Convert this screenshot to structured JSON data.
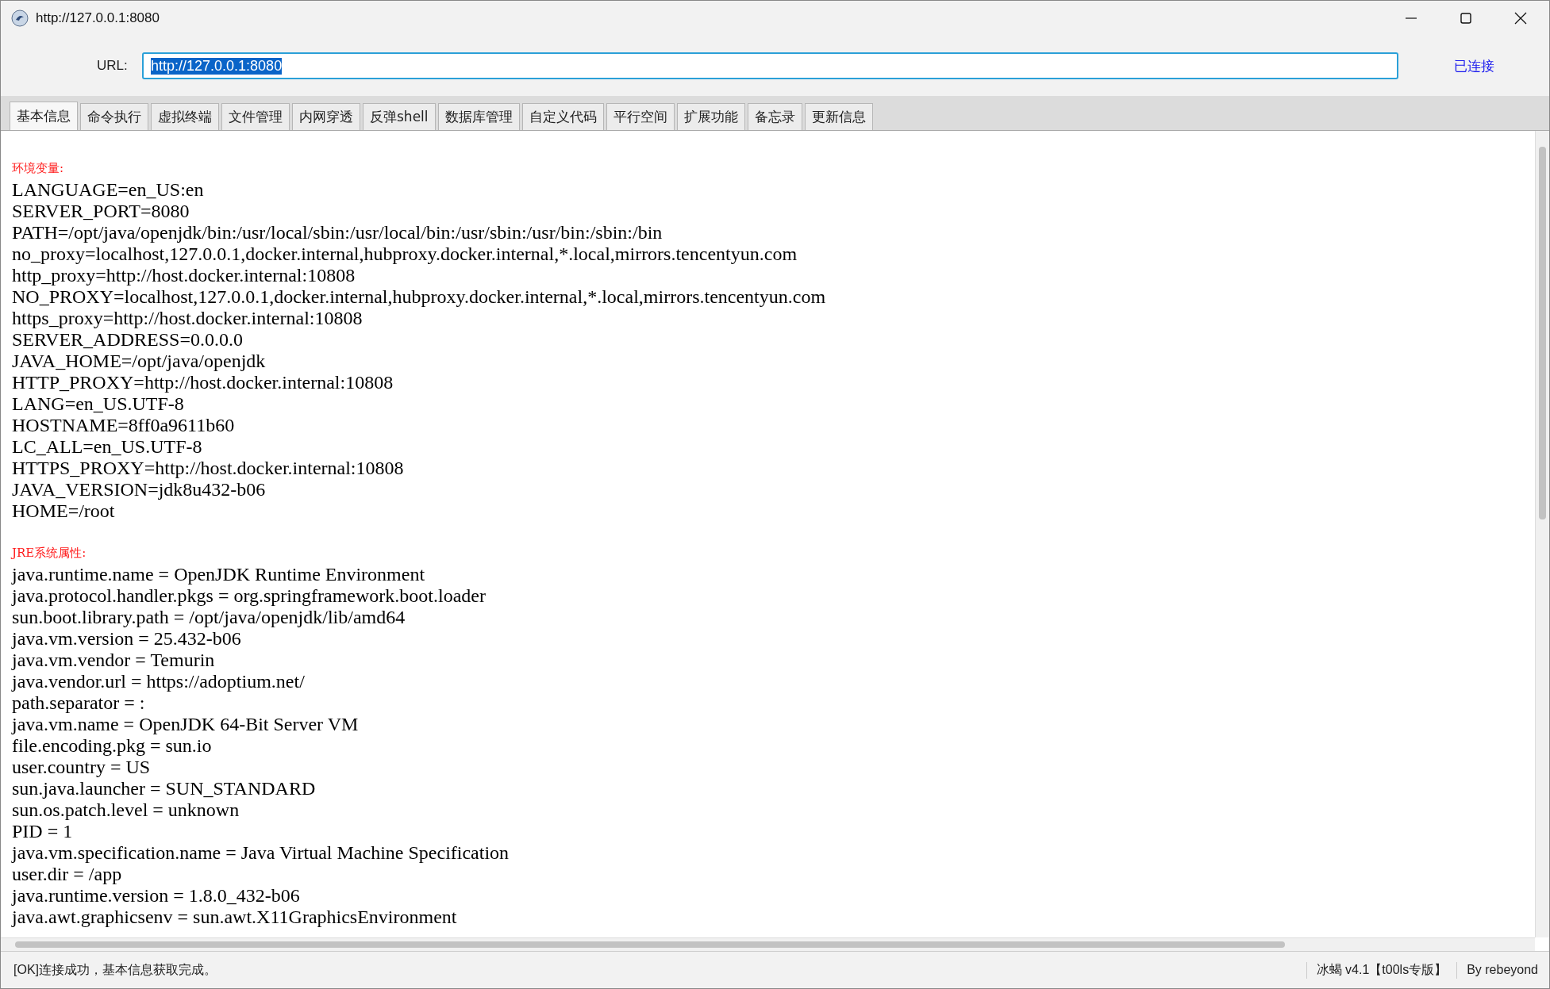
{
  "window": {
    "title": "http://127.0.0.1:8080"
  },
  "url_bar": {
    "label": "URL:",
    "value": "http://127.0.0.1:8080",
    "connection_status": "已连接"
  },
  "tabs": [
    {
      "label": "基本信息",
      "selected": true
    },
    {
      "label": "命令执行",
      "selected": false
    },
    {
      "label": "虚拟终端",
      "selected": false
    },
    {
      "label": "文件管理",
      "selected": false
    },
    {
      "label": "内网穿透",
      "selected": false
    },
    {
      "label": "反弹shell",
      "selected": false
    },
    {
      "label": "数据库管理",
      "selected": false
    },
    {
      "label": "自定义代码",
      "selected": false
    },
    {
      "label": "平行空间",
      "selected": false
    },
    {
      "label": "扩展功能",
      "selected": false
    },
    {
      "label": "备忘录",
      "selected": false
    },
    {
      "label": "更新信息",
      "selected": false
    }
  ],
  "content": {
    "sections": [
      {
        "heading": "环境变量:",
        "lines": [
          "LANGUAGE=en_US:en",
          "SERVER_PORT=8080",
          "PATH=/opt/java/openjdk/bin:/usr/local/sbin:/usr/local/bin:/usr/sbin:/usr/bin:/sbin:/bin",
          "no_proxy=localhost,127.0.0.1,docker.internal,hubproxy.docker.internal,*.local,mirrors.tencentyun.com",
          "http_proxy=http://host.docker.internal:10808",
          "NO_PROXY=localhost,127.0.0.1,docker.internal,hubproxy.docker.internal,*.local,mirrors.tencentyun.com",
          "https_proxy=http://host.docker.internal:10808",
          "SERVER_ADDRESS=0.0.0.0",
          "JAVA_HOME=/opt/java/openjdk",
          "HTTP_PROXY=http://host.docker.internal:10808",
          "LANG=en_US.UTF-8",
          "HOSTNAME=8ff0a9611b60",
          "LC_ALL=en_US.UTF-8",
          "HTTPS_PROXY=http://host.docker.internal:10808",
          "JAVA_VERSION=jdk8u432-b06",
          "HOME=/root"
        ]
      },
      {
        "heading": "JRE系统属性:",
        "lines": [
          "java.runtime.name = OpenJDK Runtime Environment",
          "java.protocol.handler.pkgs = org.springframework.boot.loader",
          "sun.boot.library.path = /opt/java/openjdk/lib/amd64",
          "java.vm.version = 25.432-b06",
          "java.vm.vendor = Temurin",
          "java.vendor.url = https://adoptium.net/",
          "path.separator = :",
          "java.vm.name = OpenJDK 64-Bit Server VM",
          "file.encoding.pkg = sun.io",
          "user.country = US",
          "sun.java.launcher = SUN_STANDARD",
          "sun.os.patch.level = unknown",
          "PID = 1",
          "java.vm.specification.name = Java Virtual Machine Specification",
          "user.dir = /app",
          "java.runtime.version = 1.8.0_432-b06",
          "java.awt.graphicsenv = sun.awt.X11GraphicsEnvironment"
        ]
      }
    ]
  },
  "status_bar": {
    "message": "[OK]连接成功，基本信息获取完成。",
    "version": "冰蝎 v4.1【t00ls专版】",
    "author": "By rebeyond"
  }
}
